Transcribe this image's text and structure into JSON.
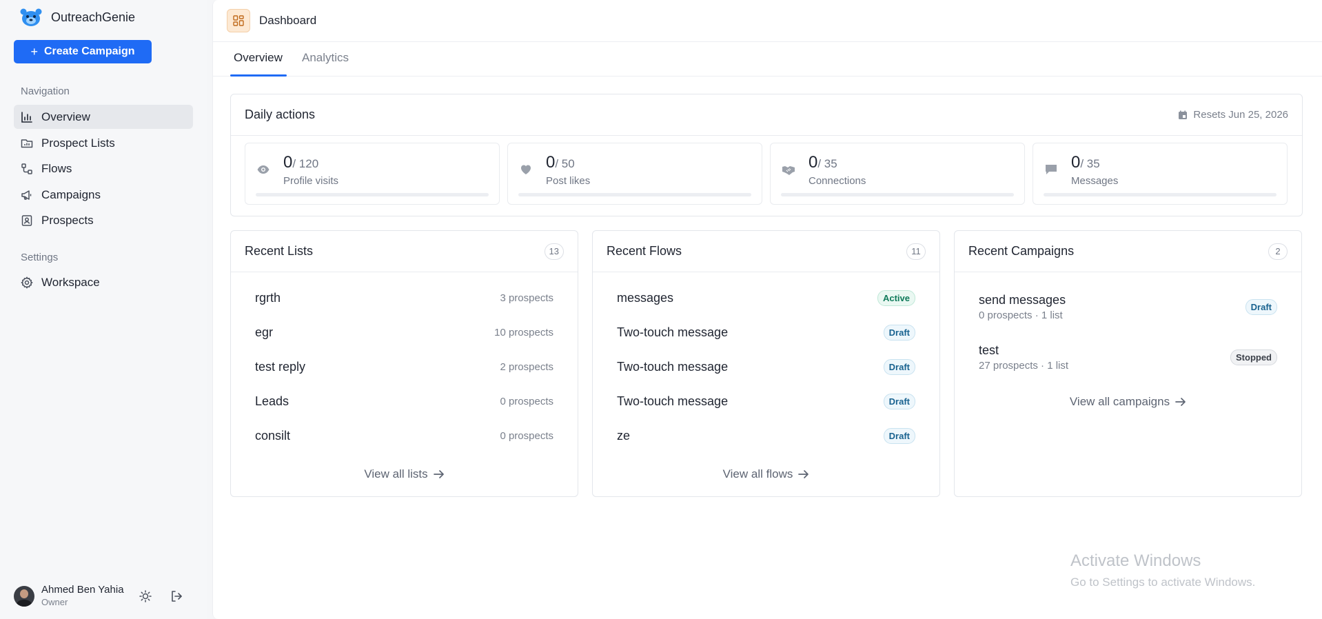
{
  "app": {
    "name": "OutreachGenie",
    "create_label": "Create Campaign"
  },
  "sidebar": {
    "nav_label": "Navigation",
    "items": [
      {
        "label": "Overview"
      },
      {
        "label": "Prospect Lists"
      },
      {
        "label": "Flows"
      },
      {
        "label": "Campaigns"
      },
      {
        "label": "Prospects"
      }
    ],
    "settings_label": "Settings",
    "settings_items": [
      {
        "label": "Workspace"
      }
    ]
  },
  "user": {
    "name": "Ahmed Ben Yahia",
    "role": "Owner"
  },
  "header": {
    "title": "Dashboard"
  },
  "tabs": [
    {
      "label": "Overview"
    },
    {
      "label": "Analytics"
    }
  ],
  "daily": {
    "title": "Daily actions",
    "resets": "Resets Jun 25, 2026",
    "metrics": [
      {
        "value": "0",
        "max": "/ 120",
        "label": "Profile visits",
        "icon": "eye-icon",
        "progress": 0
      },
      {
        "value": "0",
        "max": "/ 50",
        "label": "Post likes",
        "icon": "heart-icon",
        "progress": 0
      },
      {
        "value": "0",
        "max": "/ 35",
        "label": "Connections",
        "icon": "handshake-icon",
        "progress": 0
      },
      {
        "value": "0",
        "max": "/ 35",
        "label": "Messages",
        "icon": "message-icon",
        "progress": 0
      }
    ]
  },
  "lists": {
    "title": "Recent Lists",
    "count": "13",
    "items": [
      {
        "name": "rgrth",
        "meta": "3 prospects"
      },
      {
        "name": "egr",
        "meta": "10 prospects"
      },
      {
        "name": "test reply",
        "meta": "2 prospects"
      },
      {
        "name": "Leads",
        "meta": "0 prospects"
      },
      {
        "name": "consilt",
        "meta": "0 prospects"
      }
    ],
    "view_all": "View all lists"
  },
  "flows": {
    "title": "Recent Flows",
    "count": "11",
    "items": [
      {
        "name": "messages",
        "status": "Active"
      },
      {
        "name": "Two-touch message",
        "status": "Draft"
      },
      {
        "name": "Two-touch message",
        "status": "Draft"
      },
      {
        "name": "Two-touch message",
        "status": "Draft"
      },
      {
        "name": "ze",
        "status": "Draft"
      }
    ],
    "view_all": "View all flows"
  },
  "campaigns": {
    "title": "Recent Campaigns",
    "count": "2",
    "items": [
      {
        "name": "send messages",
        "sub": "0 prospects · 1 list",
        "status": "Draft"
      },
      {
        "name": "test",
        "sub": "27 prospects · 1 list",
        "status": "Stopped"
      }
    ],
    "view_all": "View all campaigns"
  },
  "watermark": {
    "line1": "Activate Windows",
    "line2": "Go to Settings to activate Windows."
  },
  "colors": {
    "accent": "#1f6bf5",
    "active_badge": "#0f7a5a",
    "draft_badge": "#1a6390"
  }
}
